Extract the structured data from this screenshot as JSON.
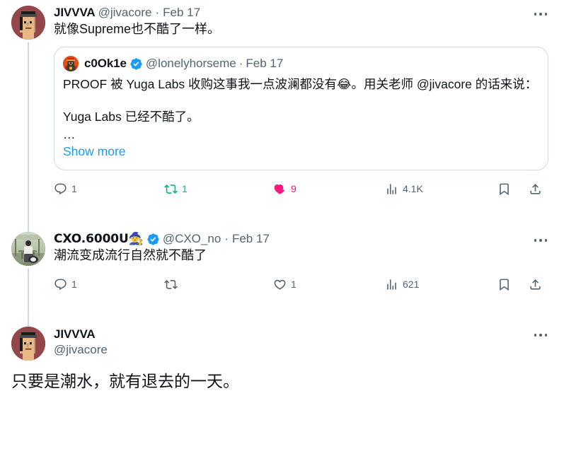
{
  "thread": {
    "tweets": [
      {
        "id": "tweet-1",
        "display_name": "JIVVVA",
        "handle": "@jivacore",
        "separator": "·",
        "date": "Feb 17",
        "verified": false,
        "text": "就像Supreme也不酷了一样。",
        "avatar": "pixel-punk-red-avatar",
        "more_label": "More",
        "quote": {
          "display_name": "c0Ok1e",
          "handle": "@lonelyhorseme",
          "separator": "·",
          "date": "Feb 17",
          "verified": true,
          "avatar": "pixel-orange-avatar",
          "text_line_1": "PROOF 被 Yuga Labs 收购这事我一点波澜都没有😂。用关老师 @jivacore 的话来说：",
          "text_line_2": "Yuga Labs 已经不酷了。",
          "ellipsis": "…",
          "show_more_label": "Show more"
        },
        "actions": {
          "reply": {
            "icon": "reply-icon",
            "count": "1",
            "active": false
          },
          "retweet": {
            "icon": "retweet-icon",
            "count": "1",
            "active": true
          },
          "like": {
            "icon": "heart-icon",
            "count": "9",
            "active": true
          },
          "views": {
            "icon": "views-icon",
            "count": "4.1K",
            "active": false
          },
          "bookmark": {
            "icon": "bookmark-icon",
            "count": "",
            "active": false
          },
          "share": {
            "icon": "share-icon",
            "count": "",
            "active": false
          }
        }
      },
      {
        "id": "tweet-2",
        "display_name": "CXO.6000U🧙",
        "handle": "@CXO_no",
        "separator": "·",
        "date": "Feb 17",
        "verified": true,
        "text": "潮流变成流行自然就不酷了",
        "avatar": "photo-person-dog-avatar",
        "more_label": "More",
        "actions": {
          "reply": {
            "icon": "reply-icon",
            "count": "1",
            "active": false
          },
          "retweet": {
            "icon": "retweet-icon",
            "count": "",
            "active": false
          },
          "like": {
            "icon": "heart-icon",
            "count": "1",
            "active": false
          },
          "views": {
            "icon": "views-icon",
            "count": "621",
            "active": false
          },
          "bookmark": {
            "icon": "bookmark-icon",
            "count": "",
            "active": false
          },
          "share": {
            "icon": "share-icon",
            "count": "",
            "active": false
          }
        }
      },
      {
        "id": "tweet-3",
        "display_name": "JIVVVA",
        "handle": "@jivacore",
        "verified": false,
        "text": "只要是潮水，就有退去的一天。",
        "avatar": "pixel-punk-red-avatar",
        "more_label": "More"
      }
    ]
  },
  "colors": {
    "text_primary": "#0f1419",
    "text_secondary": "#536471",
    "link": "#1d9bf0",
    "verified_blue": "#1d9bf0",
    "retweet_green": "#00ba7c",
    "like_pink": "#f91880",
    "border": "#cfd9de",
    "background": "#ffffff"
  }
}
